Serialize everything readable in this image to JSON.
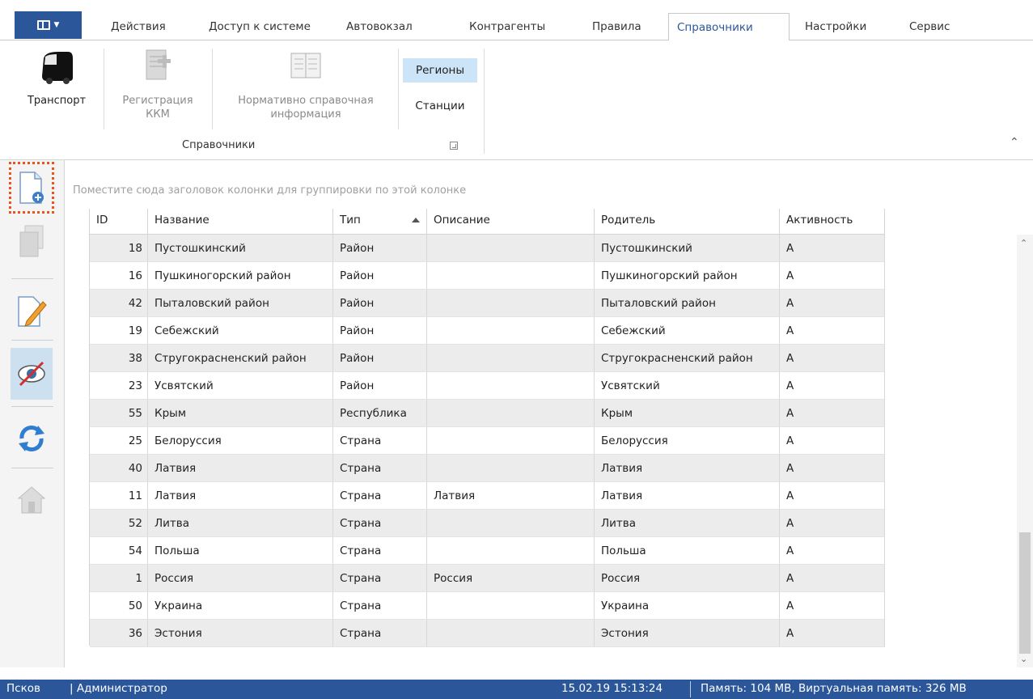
{
  "tabs": [
    {
      "label": "Действия",
      "active": false
    },
    {
      "label": "Доступ к системе",
      "active": false
    },
    {
      "label": "Автовокзал",
      "active": false
    },
    {
      "label": "Контрагенты",
      "active": false
    },
    {
      "label": "Правила",
      "active": false
    },
    {
      "label": "Справочники",
      "active": true
    },
    {
      "label": "Настройки",
      "active": false
    },
    {
      "label": "Сервис",
      "active": false
    }
  ],
  "ribbon": {
    "transport_label": "Транспорт",
    "kkm_line1": "Регистрация",
    "kkm_line2": "ККМ",
    "nsi_line1": "Нормативно справочная",
    "nsi_line2": "информация",
    "regions_label": "Регионы",
    "stations_label": "Станции",
    "group_label": "Справочники"
  },
  "grid": {
    "group_hint": "Поместите сюда заголовок колонки для группировки по этой колонке",
    "columns": [
      "ID",
      "Название",
      "Тип",
      "Описание",
      "Родитель",
      "Активность"
    ],
    "sorted_column": "Тип",
    "rows": [
      [
        "18",
        "Пустошкинский",
        "Район",
        "",
        "Пустошкинский",
        "А"
      ],
      [
        "16",
        "Пушкиногорский район",
        "Район",
        "",
        "Пушкиногорский район",
        "А"
      ],
      [
        "42",
        "Пыталовский  район",
        "Район",
        "",
        "Пыталовский  район",
        "А"
      ],
      [
        "19",
        "Себежский",
        "Район",
        "",
        "Себежский",
        "А"
      ],
      [
        "38",
        "Стругокрасненский район",
        "Район",
        "",
        "Стругокрасненский район",
        "А"
      ],
      [
        "23",
        "Усвятский",
        "Район",
        "",
        "Усвятский",
        "А"
      ],
      [
        "55",
        "Крым",
        "Республика",
        "",
        "Крым",
        "А"
      ],
      [
        "25",
        "Белоруссия",
        "Страна",
        "",
        "Белоруссия",
        "А"
      ],
      [
        "40",
        "Латвия",
        "Страна",
        "",
        "Латвия",
        "А"
      ],
      [
        "11",
        "Латвия",
        "Страна",
        "Латвия",
        "Латвия",
        "А"
      ],
      [
        "52",
        "Литва",
        "Страна",
        "",
        "Литва",
        "А"
      ],
      [
        "54",
        "Польша",
        "Страна",
        "",
        "Польша",
        "А"
      ],
      [
        "1",
        "Россия",
        "Страна",
        "Россия",
        "Россия",
        "А"
      ],
      [
        "50",
        "Украина",
        "Страна",
        "",
        "Украина",
        "А"
      ],
      [
        "36",
        "Эстония",
        "Страна",
        "",
        "Эстония",
        "А"
      ]
    ]
  },
  "statusbar": {
    "city": "Псков",
    "user": "| Администратор",
    "datetime": "15.02.19 15:13:24",
    "memory": "Память: 104 MB, Виртуальная память: 326 MB"
  },
  "colors": {
    "accent": "#2b579a",
    "selected_bg": "#cce4f7",
    "focus_outline": "#e8541c"
  }
}
